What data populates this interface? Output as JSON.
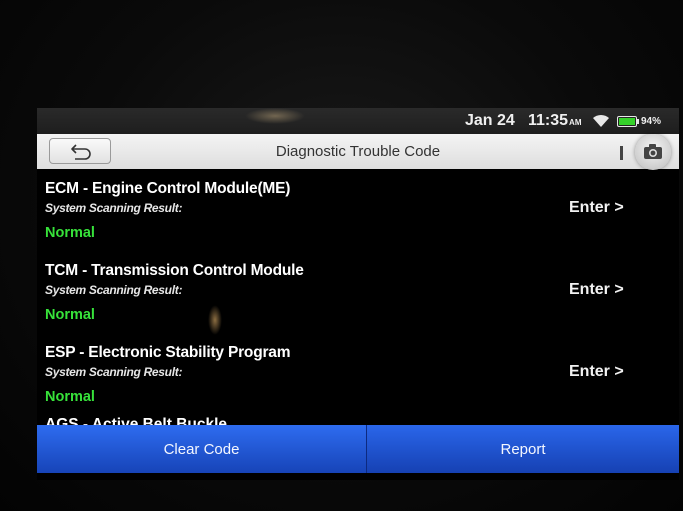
{
  "statusbar": {
    "date": "Jan 24",
    "time": "11:35",
    "ampm": "AM",
    "battery": "94%",
    "battery_color": "#35d12a"
  },
  "header": {
    "title": "Diagnostic Trouble Code",
    "back_icon": "back-arrow-icon",
    "camera_icon": "camera-icon"
  },
  "modules": [
    {
      "title": "ECM - Engine Control Module(ME)",
      "result_label": "System Scanning Result:",
      "status": "Normal",
      "action": "Enter >"
    },
    {
      "title": "TCM - Transmission Control Module",
      "result_label": "System Scanning Result:",
      "status": "Normal",
      "action": "Enter >"
    },
    {
      "title": "ESP - Electronic Stability Program",
      "result_label": "System Scanning Result:",
      "status": "Normal",
      "action": "Enter >"
    }
  ],
  "partial_module": {
    "title": "AGS - Active Belt Buckle"
  },
  "footer": {
    "clear_label": "Clear Code",
    "report_label": "Report"
  },
  "colors": {
    "status_normal": "#37e23a",
    "button_blue": "#1f56d8"
  }
}
